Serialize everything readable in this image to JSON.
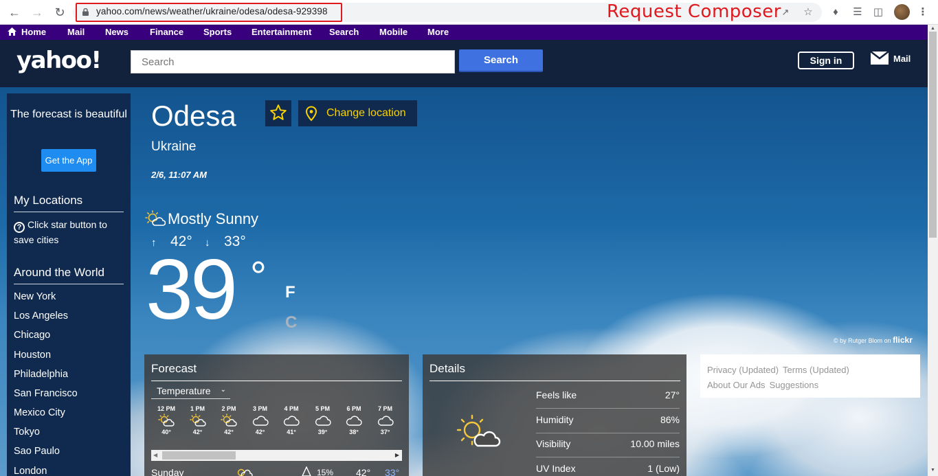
{
  "browser": {
    "url": "yahoo.com/news/weather/ukraine/odesa/odesa-929398",
    "overlay_label": "Request Composer"
  },
  "topnav": {
    "items": [
      "Home",
      "Mail",
      "News",
      "Finance",
      "Sports",
      "Entertainment",
      "Search",
      "Mobile",
      "More"
    ]
  },
  "header": {
    "logo": "yahoo!",
    "search_placeholder": "Search",
    "search_button": "Search",
    "signin": "Sign in",
    "mail": "Mail"
  },
  "sidebar": {
    "promo": "The forecast is beautiful",
    "get_app": "Get the App",
    "my_locations_heading": "My Locations",
    "my_locations_hint": "Click star button to save cities",
    "around_heading": "Around the World",
    "cities": [
      "New York",
      "Los Angeles",
      "Chicago",
      "Houston",
      "Philadelphia",
      "San Francisco",
      "Mexico City",
      "Tokyo",
      "Sao Paulo",
      "London"
    ]
  },
  "weather": {
    "city": "Odesa",
    "country": "Ukraine",
    "change_location": "Change location",
    "datetime": "2/6, 11:07 AM",
    "condition": "Mostly Sunny",
    "high": "42°",
    "low": "33°",
    "current_temp": "39",
    "degree_symbol": "°",
    "unit_f": "F",
    "unit_c": "C",
    "accent_color": "#fcd200"
  },
  "photo_credit": {
    "prefix": "© by Rutger Blom on",
    "site": "flickr"
  },
  "forecast": {
    "title": "Forecast",
    "selector": "Temperature",
    "hours": [
      {
        "time": "12 PM",
        "icon": "sun-cloud-icon",
        "temp": "40°"
      },
      {
        "time": "1 PM",
        "icon": "sun-cloud-icon",
        "temp": "42°"
      },
      {
        "time": "2 PM",
        "icon": "sun-cloud-icon",
        "temp": "42°"
      },
      {
        "time": "3 PM",
        "icon": "cloud-icon",
        "temp": "42°"
      },
      {
        "time": "4 PM",
        "icon": "cloud-icon",
        "temp": "41°"
      },
      {
        "time": "5 PM",
        "icon": "cloud-icon",
        "temp": "39°"
      },
      {
        "time": "6 PM",
        "icon": "cloud-icon",
        "temp": "38°"
      },
      {
        "time": "7 PM",
        "icon": "cloud-icon",
        "temp": "37°"
      }
    ],
    "day": {
      "name": "Sunday",
      "precip": "15%",
      "high": "42°",
      "low": "33°"
    }
  },
  "details": {
    "title": "Details",
    "rows": [
      {
        "label": "Feels like",
        "value": "27°"
      },
      {
        "label": "Humidity",
        "value": "86%"
      },
      {
        "label": "Visibility",
        "value": "10.00 miles"
      },
      {
        "label": "UV Index",
        "value": "1 (Low)"
      }
    ]
  },
  "footer": {
    "links": [
      "Privacy (Updated)",
      "Terms (Updated)",
      "About Our Ads",
      "Suggestions"
    ]
  }
}
